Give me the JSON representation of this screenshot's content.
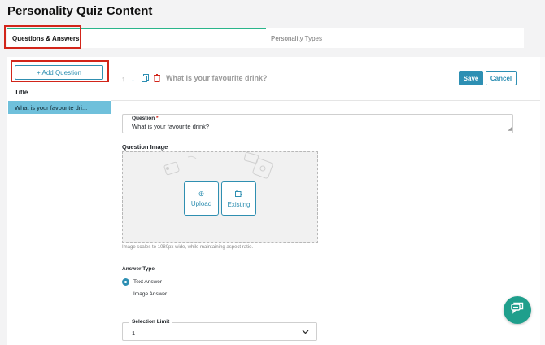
{
  "page": {
    "title": "Personality Quiz Content"
  },
  "tabs": [
    {
      "label": "Questions & Answers",
      "active": true
    },
    {
      "label": "Personality Types",
      "active": false
    }
  ],
  "sidebar": {
    "add_button_label": "+ Add Question",
    "column_title": "Title",
    "items": [
      {
        "label": "What is your favourite dri..."
      }
    ]
  },
  "toolbar": {
    "icons": [
      "arrow-up-icon",
      "arrow-down-icon",
      "copy-icon",
      "trash-icon"
    ],
    "question_heading": "What is your favourite drink?",
    "save_label": "Save",
    "cancel_label": "Cancel"
  },
  "question_field": {
    "label": "Question",
    "required_marker": "*",
    "value": "What is your favourite drink?"
  },
  "question_image": {
    "label": "Question Image",
    "upload_label": "Upload",
    "existing_label": "Existing",
    "hint": "Image scales to 1080px wide, while maintaining aspect ratio."
  },
  "answer_type": {
    "label": "Answer Type",
    "options": [
      {
        "label": "Text Answer",
        "selected": true
      },
      {
        "label": "Image Answer",
        "selected": false
      }
    ]
  },
  "selection_limit": {
    "label": "Selection Limit",
    "value": "1"
  },
  "colors": {
    "accent": "#2d8fb3",
    "active_tab": "#2ab58a",
    "selected_item": "#6fc0db",
    "highlight": "#d2251a",
    "chat": "#1f9f8c"
  }
}
